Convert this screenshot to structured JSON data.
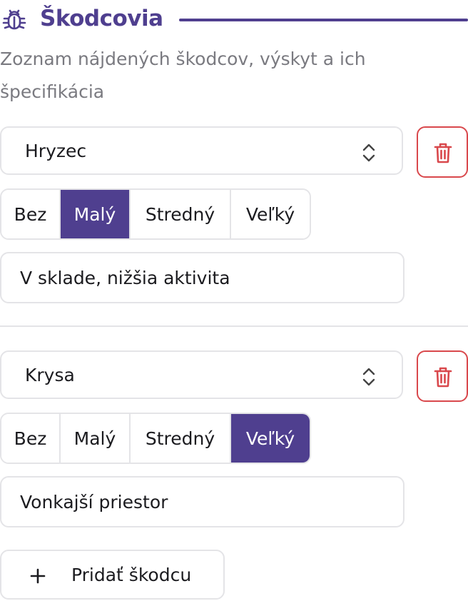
{
  "section": {
    "icon": "bug-icon",
    "title": "Škodcovia",
    "subtitle": "Zoznam nájdených škodcov, výskyt a ich špecifikácia",
    "accent_color": "#4f3f8f"
  },
  "pests": [
    {
      "name": "Hryzec",
      "levels": [
        "Bez",
        "Malý",
        "Stredný",
        "Veľký"
      ],
      "selected_level": "Malý",
      "note": "V sklade, nižšia aktivita"
    },
    {
      "name": "Krysa",
      "levels": [
        "Bez",
        "Malý",
        "Stredný",
        "Veľký"
      ],
      "selected_level": "Veľký",
      "note": "Vonkajší priestor"
    }
  ],
  "icons": {
    "select": "chevron-up-down-icon",
    "delete": "trash-icon",
    "add": "plus-icon"
  },
  "delete_color": "#d9484c",
  "add_button": {
    "label": "Pridať škodcu"
  }
}
